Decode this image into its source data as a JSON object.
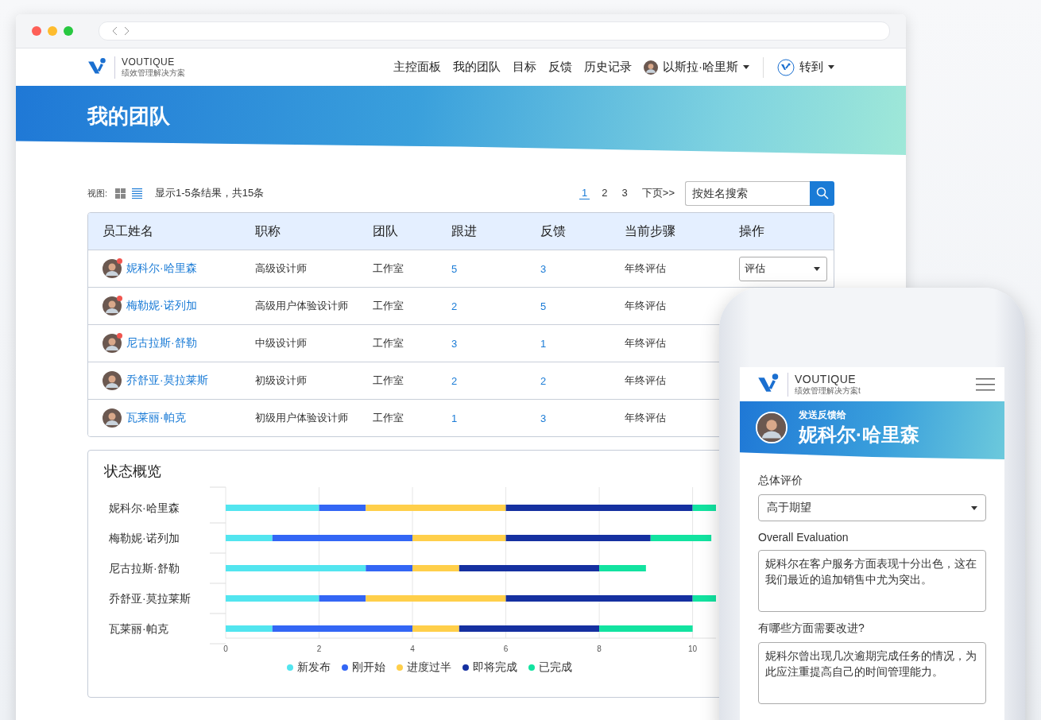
{
  "browser": {
    "nav": {
      "logo": {
        "name": "VOUTIQUE",
        "tagline": "绩效管理解决方案"
      },
      "links": [
        "主控面板",
        "我的团队",
        "目标",
        "反馈",
        "历史记录"
      ],
      "user": "以斯拉·哈里斯",
      "goto": "转到"
    },
    "hero": {
      "title": "我的团队"
    },
    "toolbar": {
      "view_label": "视图:",
      "view_options": [
        {
          "kind": "grid",
          "selected": false
        },
        {
          "kind": "list",
          "selected": true
        }
      ],
      "results": "显示1-5条结果，共15条",
      "pages": [
        {
          "label": "1",
          "selected": true
        },
        {
          "label": "2",
          "selected": false
        },
        {
          "label": "3",
          "selected": false
        }
      ],
      "next": "下页>>",
      "search": {
        "placeholder": "按姓名搜索"
      }
    },
    "table": {
      "columns": [
        "员工姓名",
        "职称",
        "团队",
        "跟进",
        "反馈",
        "当前步骤",
        "操作"
      ],
      "rows": [
        {
          "name": "妮科尔·哈里森",
          "notification": true,
          "title": "高级设计师",
          "team": "工作室",
          "follow_ups": "5",
          "feedback": "3",
          "step": "年终评估",
          "action": "评估"
        },
        {
          "name": "梅勒妮·诺列加",
          "notification": true,
          "title": "高级用户体验设计师",
          "team": "工作室",
          "follow_ups": "2",
          "feedback": "5",
          "step": "年终评估"
        },
        {
          "name": "尼古拉斯·舒勒",
          "notification": true,
          "title": "中级设计师",
          "team": "工作室",
          "follow_ups": "3",
          "feedback": "1",
          "step": "年终评估"
        },
        {
          "name": "乔舒亚·莫拉莱斯",
          "notification": false,
          "title": "初级设计师",
          "team": "工作室",
          "follow_ups": "2",
          "feedback": "2",
          "step": "年终评估"
        },
        {
          "name": "瓦莱丽·帕克",
          "notification": false,
          "title": "初级用户体验设计师",
          "team": "工作室",
          "follow_ups": "1",
          "feedback": "3",
          "step": "年终评估"
        }
      ]
    },
    "status_overview": {
      "title": "状态概览",
      "chart_data": {
        "type": "bar",
        "orientation": "horizontal",
        "stacked": true,
        "categories": [
          "妮科尔·哈里森",
          "梅勒妮·诺列加",
          "尼古拉斯·舒勒",
          "乔舒亚·莫拉莱斯",
          "瓦莱丽·帕克"
        ],
        "xticks": [
          0,
          2,
          4,
          6,
          8,
          10
        ],
        "xlim": [
          0,
          10.5
        ],
        "grid": true,
        "series": [
          {
            "name": "新发布",
            "color": "#52e5ef",
            "values": [
              2,
              1,
              3,
              2,
              1
            ]
          },
          {
            "name": "刚开始",
            "color": "#3366f5",
            "values": [
              1,
              3,
              1,
              1,
              3
            ]
          },
          {
            "name": "进度过半",
            "color": "#ffcf4a",
            "values": [
              3,
              2,
              1,
              3,
              1
            ]
          },
          {
            "name": "即将完成",
            "color": "#1530a0",
            "values": [
              4,
              3.1,
              3,
              4,
              3
            ]
          },
          {
            "name": "已完成",
            "color": "#12e3a0",
            "values": [
              0.5,
              1.3,
              1,
              0.5,
              2
            ]
          }
        ]
      }
    }
  },
  "phone": {
    "logo": {
      "name": "VOUTIQUE",
      "tagline": "绩效管理解决方案t"
    },
    "banner": {
      "subtitle": "发送反馈给",
      "name": "妮科尔·哈里森"
    },
    "form": [
      {
        "kind": "select",
        "label": "总体评价",
        "value": "高于期望"
      },
      {
        "kind": "textarea",
        "label": "Overall Evaluation",
        "value": "妮科尔在客户服务方面表现十分出色，这在我们最近的追加销售中尤为突出。"
      },
      {
        "kind": "textarea",
        "label": "有哪些方面需要改进?",
        "value": "妮科尔曾出现几次逾期完成任务的情况，为此应注重提高自己的时间管理能力。"
      }
    ]
  }
}
